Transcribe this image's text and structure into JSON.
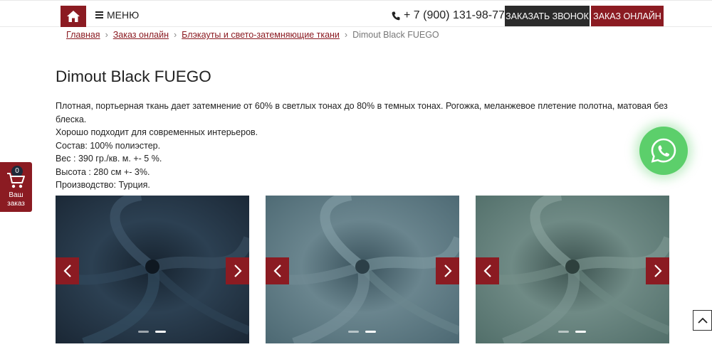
{
  "header": {
    "home_icon": "home-icon",
    "menu_label": "МЕНЮ",
    "phone": "+ 7 (900) 131-98-77",
    "call_button": "ЗАКАЗАТЬ ЗВОНОК",
    "order_button": "ЗАКАЗ ОНЛАЙН",
    "accent_color": "#8b1b22"
  },
  "breadcrumb": {
    "items": [
      "Главная",
      "Заказ онлайн",
      "Блэкауты и свето-затемняющие ткани"
    ],
    "current": "Dimout Black FUEGO",
    "separator": "›"
  },
  "product": {
    "title": "Dimout Black FUEGO",
    "description_lines": [
      "Плотная, портьерная ткань дает затемнение от 60% в светлых тонах до 80% в темных тонах. Рогожка, меланжевое плетение полотна, матовая без блеска.",
      "Хорошо подходит для современных интерьеров.",
      "Состав: 100% полиэстер.",
      "Вес : 390 гр./кв. м. +- 5 %.",
      "Высота : 280 см +- 3%.",
      "Производство: Турция."
    ]
  },
  "cart": {
    "count": "0",
    "label_line1": "Ваш",
    "label_line2": "заказ"
  },
  "gallery": [
    {
      "color": "#1f2e3d",
      "highlight": "#3d5468",
      "prev": "‹",
      "next": "›"
    },
    {
      "color": "#4a6570",
      "highlight": "#7b969f",
      "prev": "‹",
      "next": "›"
    },
    {
      "color": "#4f6a66",
      "highlight": "#809a95",
      "prev": "‹",
      "next": "›"
    }
  ]
}
